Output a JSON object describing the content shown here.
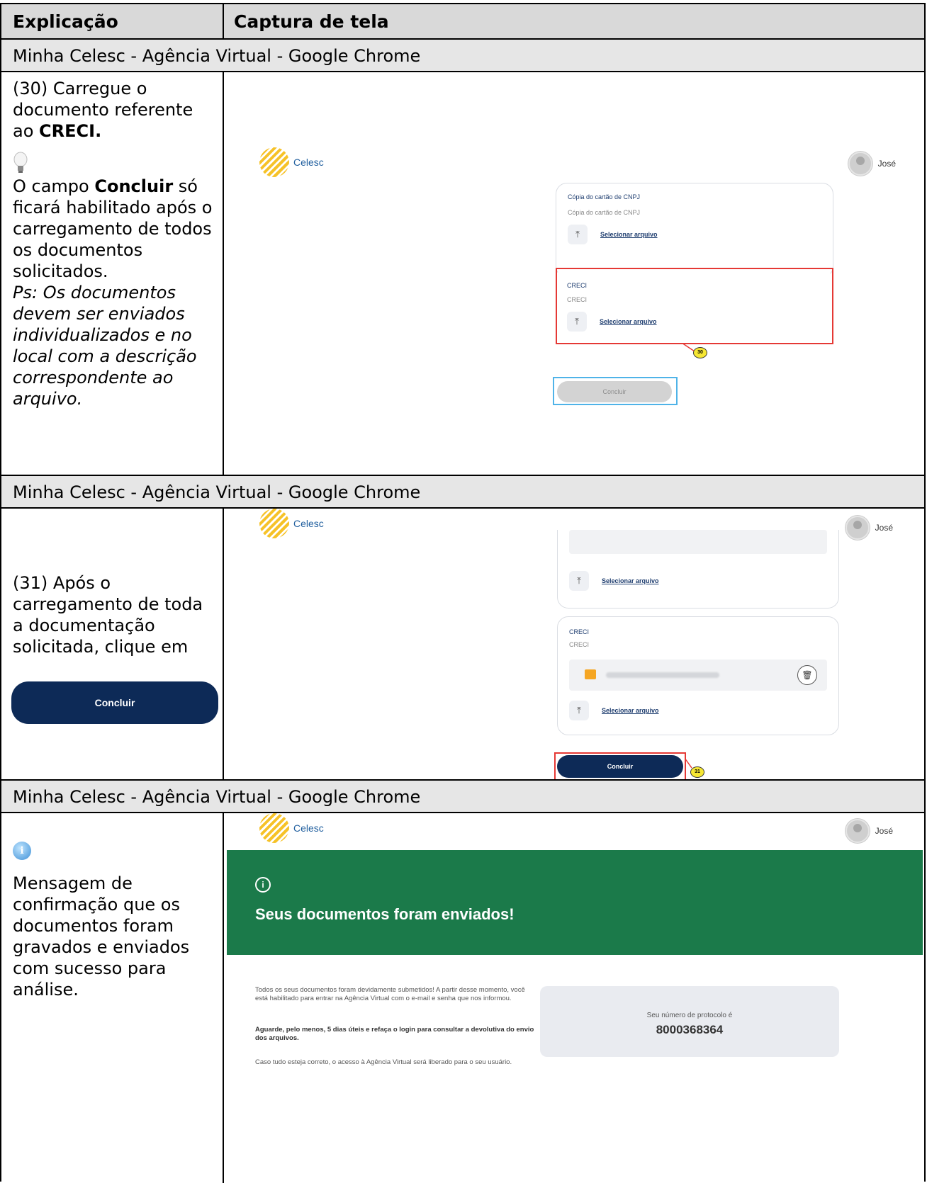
{
  "header": {
    "col1": "Explicação",
    "col2": "Captura de tela"
  },
  "window_title": "Minha Celesc - Agência Virtual - Google Chrome",
  "step30": {
    "text_line1": "(30) Carregue o documento referente ao ",
    "text_bold": "CRECI.",
    "tip_pre": "O campo ",
    "tip_bold": "Concluir",
    "tip_post": " só ficará habilitado após o carregamento de todos os documentos solicitados.",
    "ps": "Ps: Os documentos devem ser enviados individualizados e no local com a descrição correspondente ao arquivo.",
    "screen": {
      "logo": "Celesc",
      "user": "José",
      "card1_title": "Cópia do cartão de CNPJ",
      "card1_sub": "Cópia do cartão de CNPJ",
      "card2_title": "CRECI",
      "card2_sub": "CRECI",
      "upload_label": "Selecionar arquivo",
      "badge": "30",
      "button": "Concluir"
    }
  },
  "step31": {
    "text": "(31) Após o carregamento de toda a documentação solicitada, clique em",
    "button": "Concluir",
    "screen": {
      "logo": "Celesc",
      "user": "José",
      "upload_label": "Selecionar arquivo",
      "card_title": "CRECI",
      "card_sub": "CRECI",
      "badge": "31",
      "button": "Concluir"
    }
  },
  "step32": {
    "text": "Mensagem de confirmação que os documentos foram gravados e enviados com sucesso para análise.",
    "screen": {
      "logo": "Celesc",
      "user": "José",
      "banner_title": "Seus documentos foram enviados!",
      "para1": "Todos os seus documentos foram devidamente submetidos! A partir desse momento, você está habilitado para entrar na Agência Virtual com o e-mail e senha que nos informou.",
      "para2": "Aguarde, pelo menos, 5 dias úteis e refaça o login para consultar a devolutiva do envio dos arquivos.",
      "para3": "Caso tudo esteja correto, o acesso à Agência Virtual será liberado para o seu usuário.",
      "protocol_label": "Seu número de protocolo é",
      "protocol_number": "8000368364"
    }
  },
  "colors": {
    "navy": "#0d2a57",
    "green": "#1b7a4a",
    "red_box": "#e53935",
    "header_gray": "#d9d9d9"
  }
}
